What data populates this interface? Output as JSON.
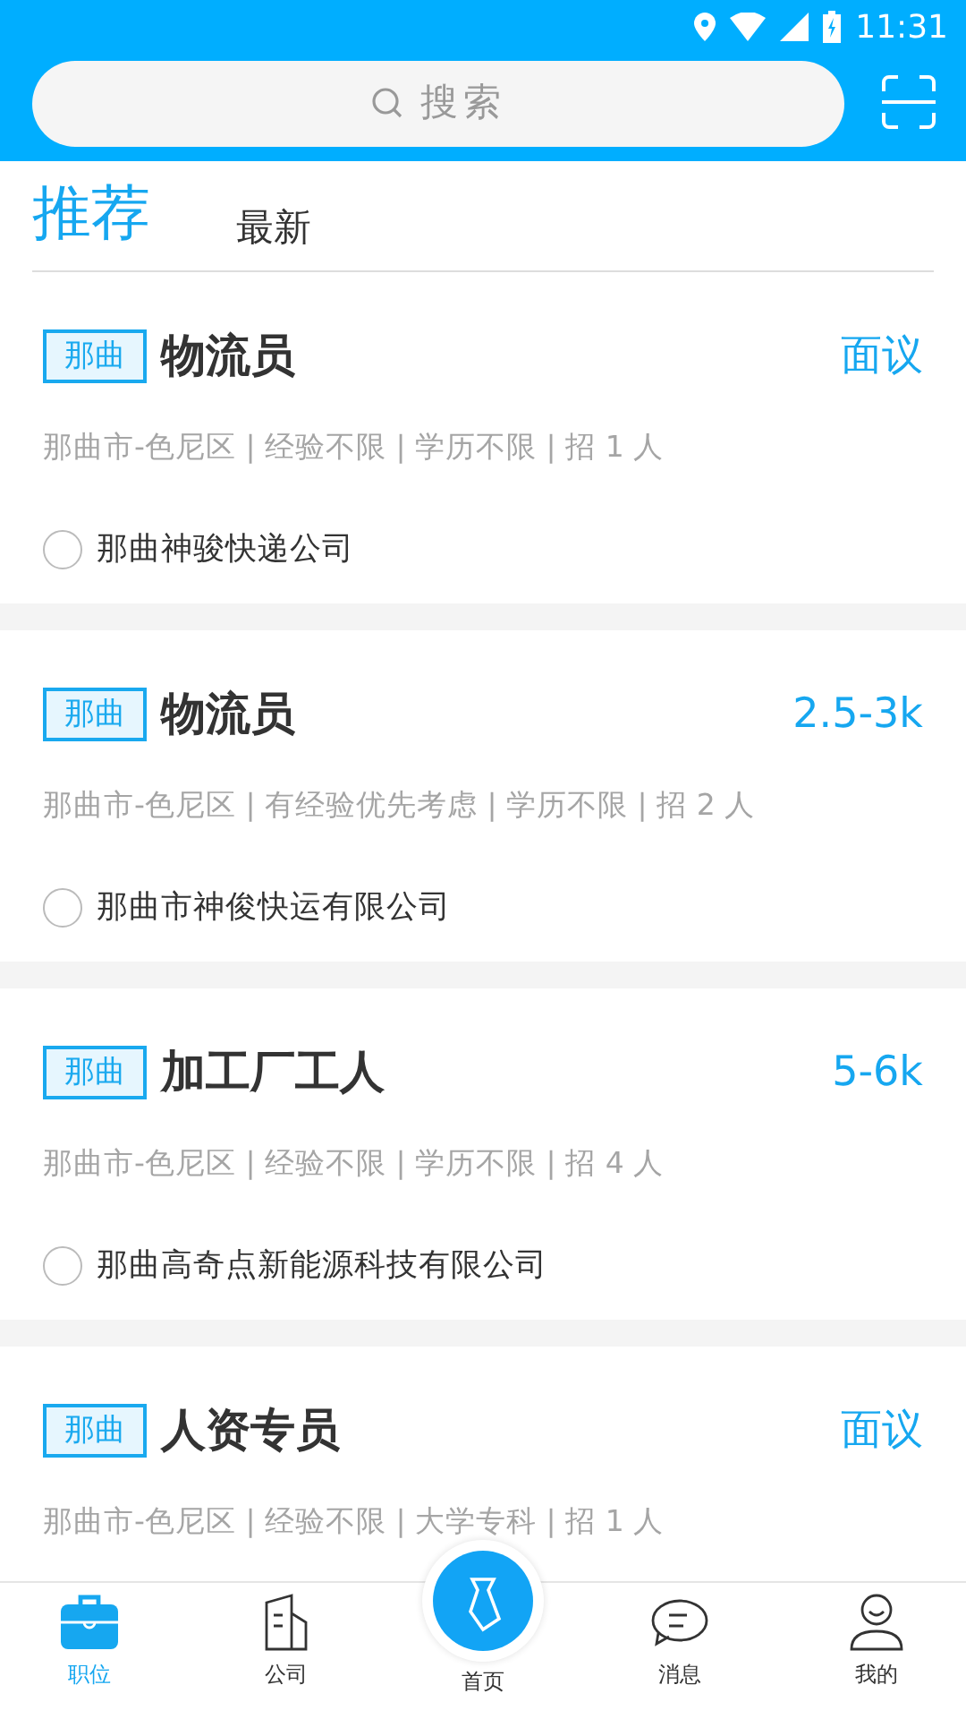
{
  "status_bar": {
    "time": "11:31"
  },
  "search": {
    "placeholder": "搜索"
  },
  "tabs": [
    {
      "label": "推荐",
      "selected": true
    },
    {
      "label": "最新",
      "selected": false
    }
  ],
  "jobs": [
    {
      "tag": "那曲",
      "title": "物流员",
      "salary": "面议",
      "meta": "那曲市-色尼区 | 经验不限 | 学历不限 | 招 1 人",
      "company": "那曲神骏快递公司"
    },
    {
      "tag": "那曲",
      "title": "物流员",
      "salary": "2.5-3k",
      "meta": "那曲市-色尼区 | 有经验优先考虑 | 学历不限 | 招 2 人",
      "company": "那曲市神俊快运有限公司"
    },
    {
      "tag": "那曲",
      "title": "加工厂工人",
      "salary": "5-6k",
      "meta": "那曲市-色尼区 | 经验不限 | 学历不限 | 招 4 人",
      "company": "那曲高奇点新能源科技有限公司"
    },
    {
      "tag": "那曲",
      "title": "人资专员",
      "salary": "面议",
      "meta": "那曲市-色尼区 | 经验不限 | 大学专科 | 招 1 人"
    }
  ],
  "bottom_nav": [
    {
      "label": "职位",
      "kind": "briefcase",
      "selected": true
    },
    {
      "label": "公司",
      "kind": "building",
      "selected": false
    },
    {
      "label": "首页",
      "kind": "home",
      "selected": false
    },
    {
      "label": "消息",
      "kind": "message",
      "selected": false
    },
    {
      "label": "我的",
      "kind": "profile",
      "selected": false
    }
  ]
}
